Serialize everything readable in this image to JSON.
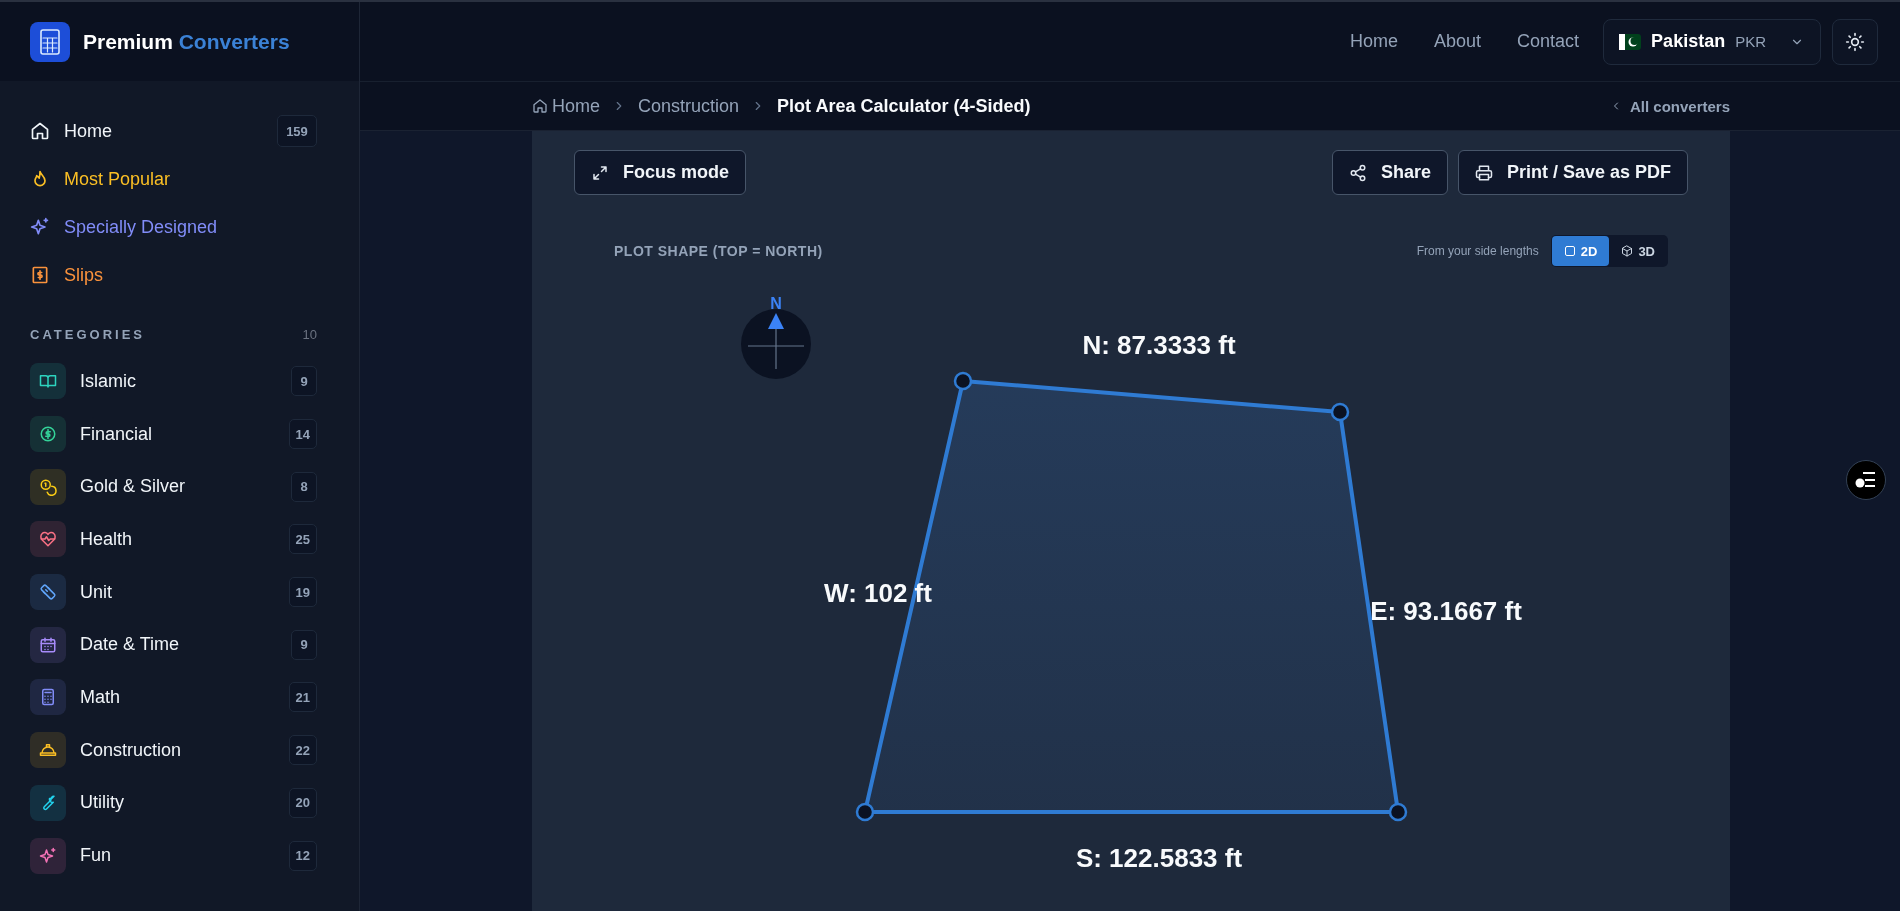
{
  "brand": {
    "first": "Premium",
    "second": "Converters"
  },
  "nav": [
    "Home",
    "About",
    "Contact"
  ],
  "country": {
    "name": "Pakistan",
    "currency": "PKR"
  },
  "sidebar": {
    "main": [
      {
        "kind": "home",
        "label": "Home",
        "count": "159",
        "color": "#f1f5f9"
      },
      {
        "kind": "fire",
        "label": "Most Popular",
        "color": "#fbbf24"
      },
      {
        "kind": "sparkle",
        "label": "Specially Designed",
        "color": "#818cf8"
      },
      {
        "kind": "slip",
        "label": "Slips",
        "color": "#fb923c"
      }
    ],
    "categories_heading": "CATEGORIES",
    "categories_count": "10",
    "categories": [
      {
        "kind": "book",
        "label": "Islamic",
        "count": "9",
        "color": "#2dd4bf"
      },
      {
        "kind": "dollar",
        "label": "Financial",
        "count": "14",
        "color": "#34d399"
      },
      {
        "kind": "coins",
        "label": "Gold & Silver",
        "count": "8",
        "color": "#facc15"
      },
      {
        "kind": "heart",
        "label": "Health",
        "count": "25",
        "color": "#fb7185"
      },
      {
        "kind": "ruler",
        "label": "Unit",
        "count": "19",
        "color": "#60a5fa"
      },
      {
        "kind": "calendar",
        "label": "Date & Time",
        "count": "9",
        "color": "#a78bfa"
      },
      {
        "kind": "calculator",
        "label": "Math",
        "count": "21",
        "color": "#818cf8"
      },
      {
        "kind": "helmet",
        "label": "Construction",
        "count": "22",
        "color": "#fbbf24"
      },
      {
        "kind": "wrench",
        "label": "Utility",
        "count": "20",
        "color": "#22d3ee"
      },
      {
        "kind": "sparkle",
        "label": "Fun",
        "count": "12",
        "color": "#f472b6"
      }
    ]
  },
  "breadcrumb": [
    "Home",
    "Construction",
    "Plot Area Calculator (4-Sided)"
  ],
  "all_converters": "All converters",
  "toolbar": {
    "focus": "Focus mode",
    "share": "Share",
    "print": "Print / Save as PDF"
  },
  "plot": {
    "heading": "PLOT SHAPE (TOP = NORTH)",
    "hint": "From your side lengths",
    "views": [
      {
        "kind": "square",
        "label": "2D",
        "selected": true
      },
      {
        "kind": "cube",
        "label": "3D",
        "selected": false
      }
    ],
    "compass": "N",
    "sides": [
      {
        "label": "N: 87.3333 ft"
      },
      {
        "label": "E: 93.1667 ft"
      },
      {
        "label": "S: 122.5833 ft"
      },
      {
        "label": "W: 102 ft"
      }
    ]
  }
}
